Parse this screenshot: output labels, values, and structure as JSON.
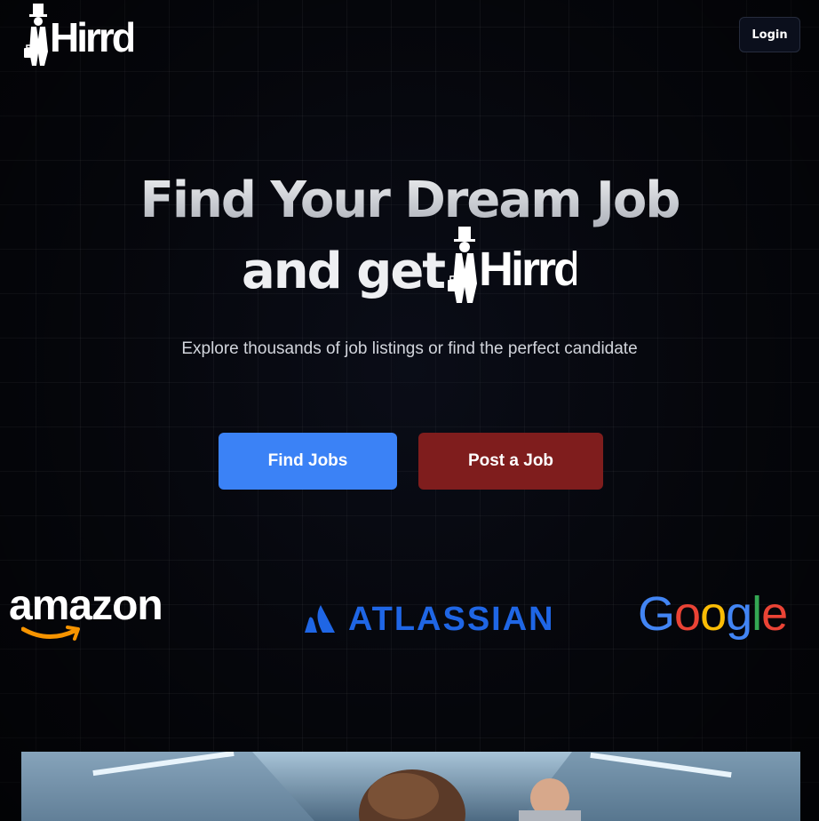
{
  "header": {
    "brand": "Hirrd",
    "login_label": "Login"
  },
  "hero": {
    "line1": "Find Your Dream Job",
    "line2": "and get",
    "brand": "Hirrd",
    "subtitle": "Explore thousands of job listings or find the perfect candidate"
  },
  "actions": {
    "find_jobs_label": "Find Jobs",
    "post_job_label": "Post a Job"
  },
  "companies": [
    {
      "name": "amazon",
      "text": "amazon"
    },
    {
      "name": "atlassian",
      "text": "ATLASSIAN"
    },
    {
      "name": "google",
      "text": "Google"
    }
  ],
  "colors": {
    "find_jobs": "#3b82f6",
    "post_job": "#7f1d1d",
    "atlassian": "#1f66e5",
    "amazon_orange": "#f79400",
    "google_blue": "#4285f4",
    "google_red": "#ea4335",
    "google_yellow": "#fbbc05",
    "google_green": "#34a853"
  },
  "icons": {
    "brand_logo": "top-hat-gentleman-with-briefcase-icon",
    "atlassian_mark": "atlassian-triangle-icon",
    "amazon_smile": "amazon-smile-arrow-icon"
  }
}
